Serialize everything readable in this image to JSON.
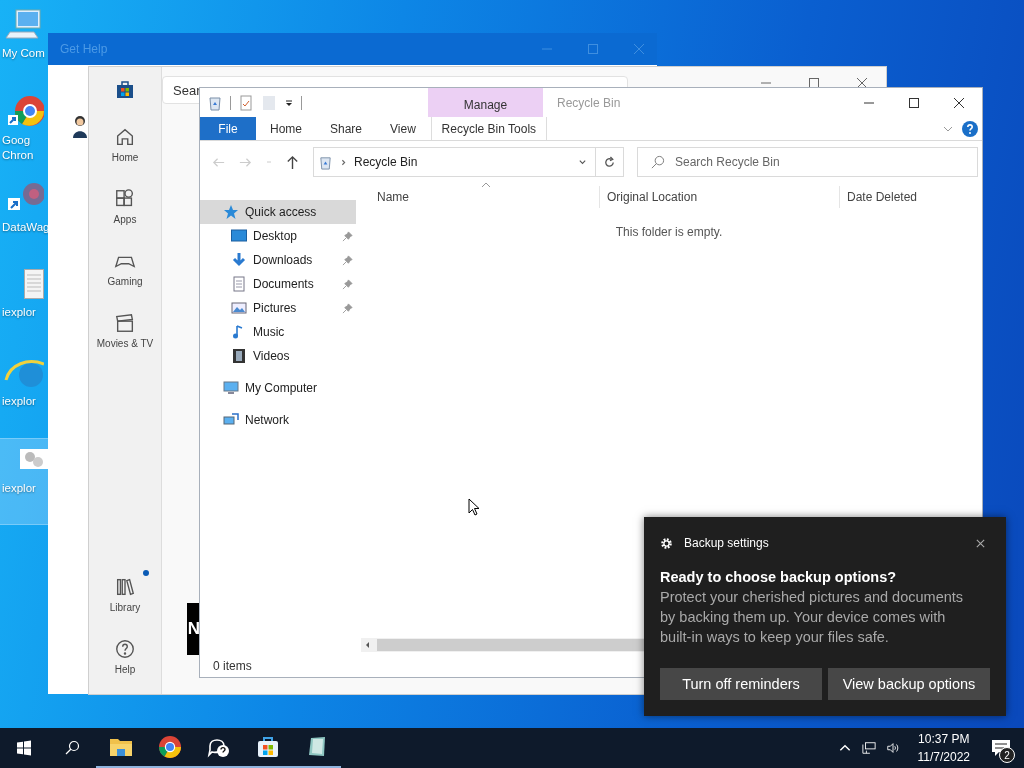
{
  "desktop_icons": [
    {
      "kind": "computer",
      "lines": [
        "My Com"
      ],
      "selected": false
    },
    {
      "kind": "chrome",
      "lines": [
        "Goog",
        "Chron"
      ],
      "selected": false
    },
    {
      "kind": "shortcut",
      "lines": [
        "DataWag"
      ],
      "selected": false
    },
    {
      "kind": "document",
      "lines": [
        "iexplor"
      ],
      "selected": false
    },
    {
      "kind": "ie",
      "lines": [
        "iexplor"
      ],
      "selected": false
    },
    {
      "kind": "gears",
      "lines": [
        "iexplor"
      ],
      "selected": true
    }
  ],
  "get_help_window": {
    "title": "Get Help"
  },
  "store_window": {
    "search_placeholder": "Sear",
    "banner_text": "N",
    "nav_top": [
      {
        "kind": "home",
        "label": "Home",
        "has_dot": false
      },
      {
        "kind": "apps",
        "label": "Apps",
        "has_dot": false
      },
      {
        "kind": "gaming",
        "label": "Gaming",
        "has_dot": false
      },
      {
        "kind": "movies",
        "label": "Movies & TV",
        "has_dot": false
      }
    ],
    "nav_bottom": [
      {
        "kind": "library",
        "label": "Library",
        "has_dot": true
      },
      {
        "kind": "help",
        "label": "Help",
        "has_dot": false
      }
    ]
  },
  "explorer": {
    "title": "Recycle Bin",
    "context_group": "Manage",
    "ribbon_tabs": [
      {
        "kind": "file",
        "label": "File"
      },
      {
        "kind": "tab",
        "label": "Home"
      },
      {
        "kind": "tab",
        "label": "Share"
      },
      {
        "kind": "tab",
        "label": "View"
      },
      {
        "kind": "context",
        "label": "Recycle Bin Tools"
      }
    ],
    "address": "Recycle Bin",
    "search_placeholder": "Search Recycle Bin",
    "nav_pane": [
      {
        "kind": "star",
        "label": "Quick access",
        "selected": true,
        "children": [
          {
            "kind": "desktop",
            "label": "Desktop",
            "pinned": true,
            "selected": false
          },
          {
            "kind": "download",
            "label": "Downloads",
            "pinned": true,
            "selected": false
          },
          {
            "kind": "documents",
            "label": "Documents",
            "pinned": true,
            "selected": false
          },
          {
            "kind": "pictures",
            "label": "Pictures",
            "pinned": true,
            "selected": false
          },
          {
            "kind": "music",
            "label": "Music",
            "pinned": false,
            "selected": false
          },
          {
            "kind": "videos",
            "label": "Videos",
            "pinned": false,
            "selected": false
          }
        ]
      },
      {
        "kind": "computer",
        "label": "My Computer",
        "selected": false
      },
      {
        "kind": "network",
        "label": "Network",
        "selected": false
      }
    ],
    "columns": [
      "Name",
      "Original Location",
      "Date Deleted"
    ],
    "empty_message": "This folder is empty.",
    "status": "0 items"
  },
  "toast": {
    "app": "Backup settings",
    "title": "Ready to choose backup options?",
    "body": "Protect your cherished pictures and documents by backing them up. Your device comes with built-in ways to keep your files safe.",
    "buttons": [
      "Turn off reminders",
      "View backup options"
    ]
  },
  "taskbar": {
    "apps": [
      {
        "kind": "explorer",
        "running": true
      },
      {
        "kind": "chrome",
        "running": true
      },
      {
        "kind": "help",
        "running": true
      },
      {
        "kind": "store",
        "running": true
      },
      {
        "kind": "notes",
        "running": true
      }
    ],
    "time": "10:37 PM",
    "date": "11/7/2022",
    "notification_count": "2"
  }
}
